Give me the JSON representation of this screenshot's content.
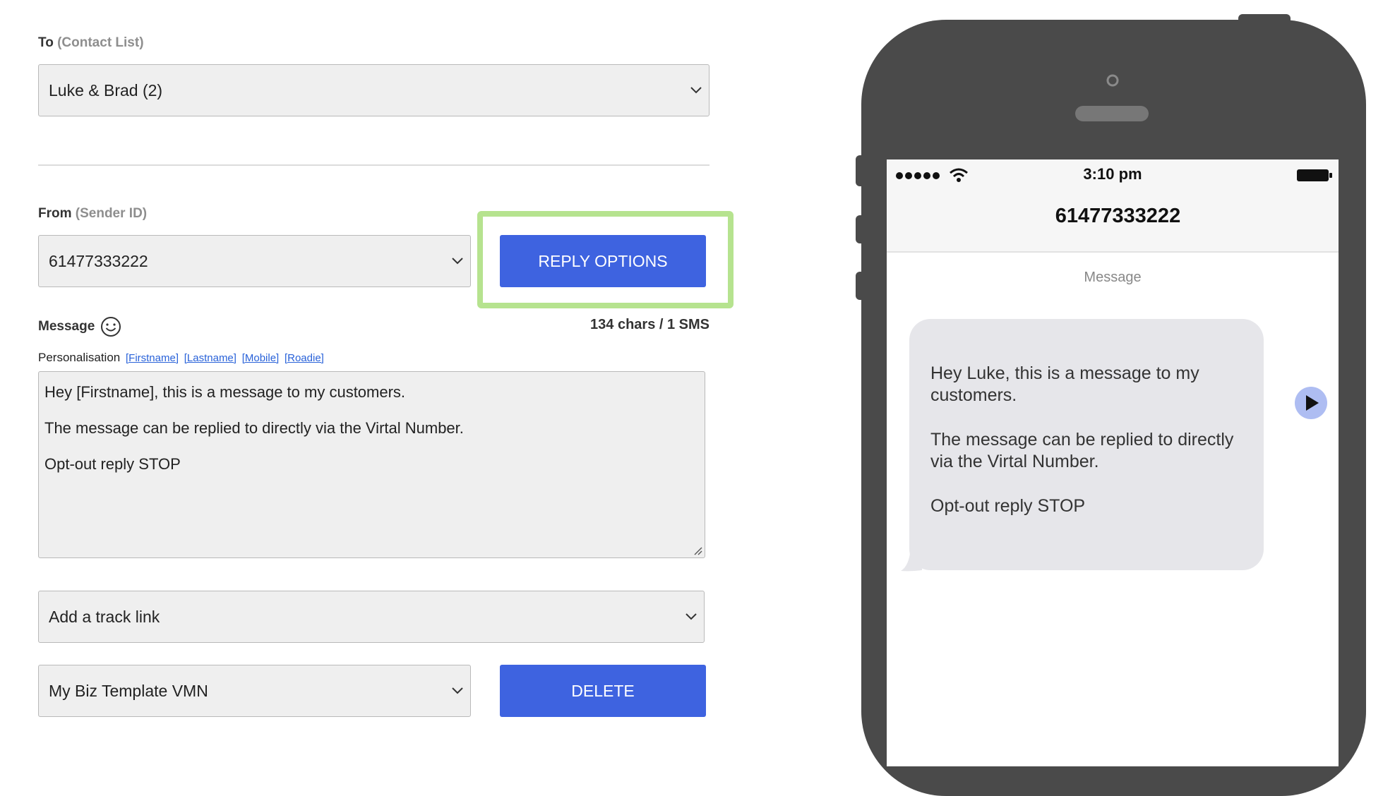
{
  "form": {
    "to": {
      "label": "To",
      "hint": "(Contact List)",
      "value": "Luke & Brad (2)"
    },
    "from": {
      "label": "From",
      "hint": "(Sender ID)",
      "value": "61477333222"
    },
    "reply_options_label": "REPLY OPTIONS",
    "message": {
      "label": "Message",
      "char_count": "134 chars / 1 SMS",
      "personalisation_label": "Personalisation",
      "tags": [
        "[Firstname]",
        "[Lastname]",
        "[Mobile]",
        "[Roadie]"
      ],
      "lines": [
        "Hey [Firstname], this is a message to my customers.",
        "The message can be replied to directly via the Virtal Number.",
        "Opt-out reply STOP"
      ]
    },
    "track_link": {
      "value": "Add a track link"
    },
    "template": {
      "value": "My Biz Template VMN"
    },
    "delete_label": "DELETE",
    "highlight_color": "#b6e38f",
    "button_color": "#3e63e0"
  },
  "phone": {
    "time": "3:10 pm",
    "contact": "61477333222",
    "thread_label": "Message",
    "bubble_lines": [
      "Hey Luke, this is a message to my customers.",
      "The message can be replied to directly via the Virtal Number.",
      "Opt-out reply STOP"
    ],
    "icons": [
      "signal-dots-icon",
      "wifi-icon",
      "battery-icon",
      "play-icon"
    ]
  }
}
